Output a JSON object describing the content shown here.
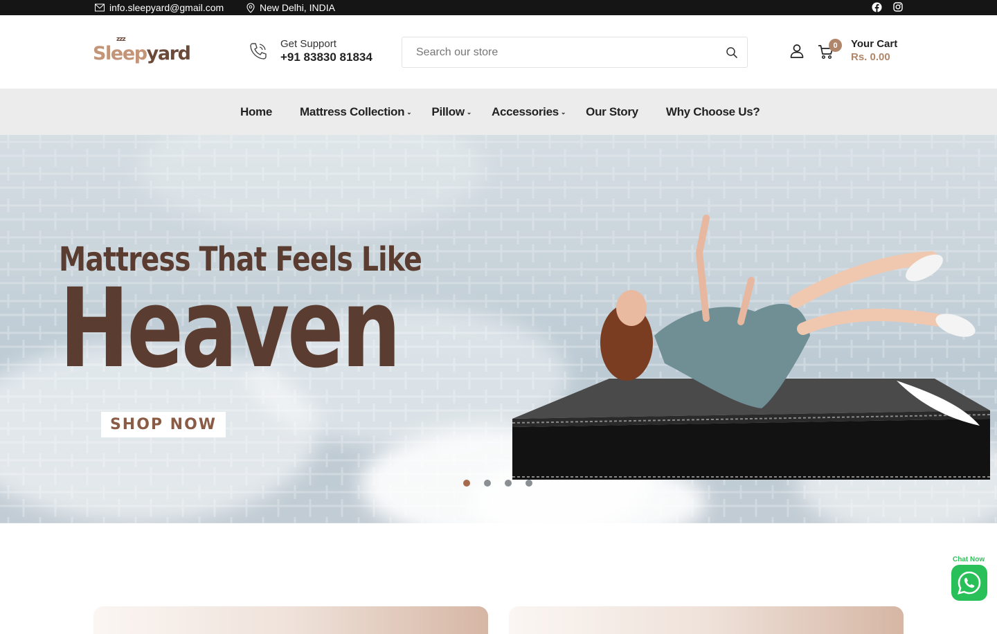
{
  "topbar": {
    "email": "info.sleepyard@gmail.com",
    "location": "New Delhi, INDIA"
  },
  "header": {
    "logo_text_a": "Sleep",
    "logo_text_b": "yard",
    "support_label": "Get Support",
    "support_phone": "+91 83830 81834",
    "search_placeholder": "Search our store",
    "cart_count": "0",
    "cart_label": "Your Cart",
    "cart_total": "Rs. 0.00"
  },
  "nav": {
    "items": [
      {
        "label": "Home"
      },
      {
        "label": "Mattress Collection"
      },
      {
        "label": "Pillow"
      },
      {
        "label": "Accessories"
      },
      {
        "label": "Our Story"
      },
      {
        "label": "Why Choose Us?"
      }
    ]
  },
  "hero": {
    "headline_line1": "Mattress That Feels Like",
    "headline_line2": "Heaven",
    "cta": "SHOP NOW",
    "slides": 4,
    "active_slide": 1
  },
  "chat": {
    "label": "Chat Now"
  },
  "colors": {
    "brand_brown": "#5a3d30",
    "accent": "#b0866a",
    "topbar": "#151515",
    "nav_bg": "#ececec",
    "whatsapp": "#29c05a"
  }
}
